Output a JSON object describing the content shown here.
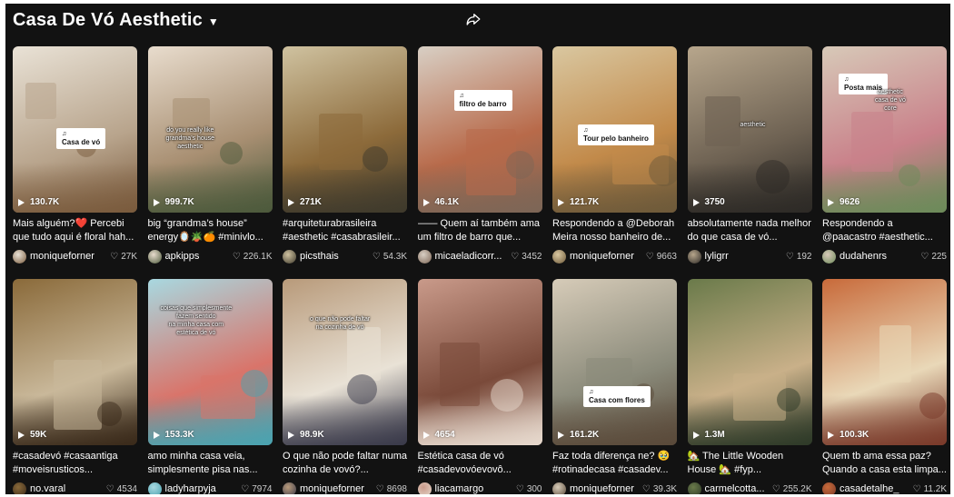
{
  "header": {
    "title": "Casa De Vó Aesthetic",
    "caret_icon": "chevron-down-icon",
    "share_icon": "share-icon"
  },
  "colors": {
    "background": "#121212",
    "text": "#ffffff",
    "muted": "#cccccc"
  },
  "videos": [
    {
      "views": "130.7K",
      "caption": "Mais alguém?❤️ Percebi que tudo aqui é floral hah...",
      "user": "moniqueforner",
      "likes": "27K",
      "overlay_label": "Casa de vó",
      "overlay_text": ""
    },
    {
      "views": "999.7K",
      "caption": "big “grandma’s house” energy🪞🪴🍊 #minivlo...",
      "user": "apkipps",
      "likes": "226.1K",
      "overlay_label": "",
      "overlay_text": "do you really like\ngrandma’s house\naesthetic"
    },
    {
      "views": "271K",
      "caption": "#arquiteturabrasileira #aesthetic #casabrasileir...",
      "user": "picsthais",
      "likes": "54.3K",
      "overlay_label": "",
      "overlay_text": ""
    },
    {
      "views": "46.1K",
      "caption": "—— Quem aí também ama um filtro de barro que...",
      "user": "micaeladicorr...",
      "likes": "3452",
      "overlay_label": "filtro de barro",
      "overlay_text": ""
    },
    {
      "views": "121.7K",
      "caption": "Respondendo a @Deborah Meira nosso banheiro de...",
      "user": "moniqueforner",
      "likes": "9663",
      "overlay_label": "Tour pelo banheiro",
      "overlay_text": ""
    },
    {
      "views": "3750",
      "caption": "absolutamente nada melhor do que casa de vó...",
      "user": "lyligrr",
      "likes": "192",
      "overlay_label": "",
      "overlay_text": "aesthetic"
    },
    {
      "views": "9626",
      "caption": "Respondendo a @paacastro #aesthetic...",
      "user": "dudahenrs",
      "likes": "225",
      "overlay_label": "Posta mais",
      "overlay_text": "aesthetic\ncasa de vó\ncore"
    },
    {
      "views": "59K",
      "caption": "#casadevó #casaantiga #moveisrusticos...",
      "user": "no.varal",
      "likes": "4534",
      "overlay_label": "",
      "overlay_text": ""
    },
    {
      "views": "153.3K",
      "caption": "amo minha casa veia, simplesmente pisa nas...",
      "user": "ladyharpyja",
      "likes": "7974",
      "overlay_label": "",
      "overlay_text": "coisas que simplesmente\nfazem sentido\nna minha casa com\nestética de vó"
    },
    {
      "views": "98.9K",
      "caption": "O que não pode faltar numa cozinha de vovó?...",
      "user": "moniqueforner",
      "likes": "8698",
      "overlay_label": "",
      "overlay_text": "o que não pode faltar\nna cozinha de vó"
    },
    {
      "views": "4654",
      "caption": "Estética casa de vó #casadevovóevovô...",
      "user": "liacamargo",
      "likes": "300",
      "overlay_label": "",
      "overlay_text": ""
    },
    {
      "views": "161.2K",
      "caption": "Faz toda diferença ne? 🥹 #rotinadecasa #casadev...",
      "user": "moniqueforner",
      "likes": "39.3K",
      "overlay_label": "Casa com flores",
      "overlay_text": ""
    },
    {
      "views": "1.3M",
      "caption": "🏡 The Little Wooden House 🏡 #fyp...",
      "user": "carmelcotta...",
      "likes": "255.2K",
      "overlay_label": "",
      "overlay_text": ""
    },
    {
      "views": "100.3K",
      "caption": "Quem tb ama essa paz? Quando a casa esta limpa...",
      "user": "casadetalhe_",
      "likes": "11.2K",
      "overlay_label": "",
      "overlay_text": ""
    }
  ]
}
